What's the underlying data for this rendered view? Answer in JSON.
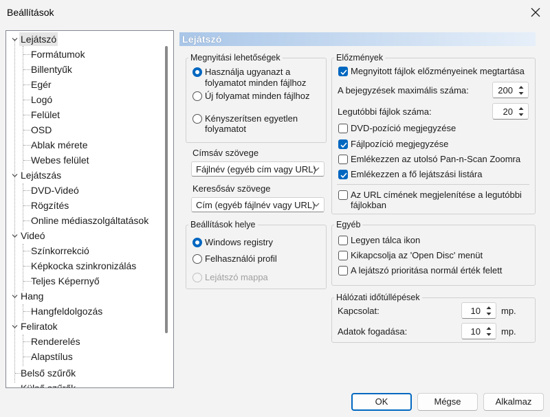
{
  "window": {
    "title": "Beállítások"
  },
  "tree": {
    "items": [
      "Lejátszó",
      "Formátumok",
      "Billentyűk",
      "Egér",
      "Logó",
      "Felület",
      "OSD",
      "Ablak mérete",
      "Webes felület",
      "Lejátszás",
      "DVD-Videó",
      "Rögzítés",
      "Online médiaszolgáltatások",
      "Videó",
      "Színkorrekció",
      "Képkocka szinkronizálás",
      "Teljes Képernyő",
      "Hang",
      "Hangfeldolgozás",
      "Feliratok",
      "Renderelés",
      "Alapstílus",
      "Belső szűrők",
      "Külső szűrők"
    ]
  },
  "page": {
    "title": "Lejátszó"
  },
  "open_options": {
    "title": "Megnyitási lehetőségek",
    "same_line1": "Használja ugyanazt a",
    "same_line2": "folyamatot minden fájlhoz",
    "new": "Új folyamat minden fájlhoz",
    "single_line1": "Kényszerítsen egyetlen",
    "single_line2": "folyamatot",
    "selected": "same"
  },
  "titlebar_text": {
    "label": "Címsáv szövege",
    "value": "Fájlnév (egyéb cím vagy URL)"
  },
  "searchbar_text": {
    "label": "Keresősáv szövege",
    "value": "Cím (egyéb fájlnév vagy URL)"
  },
  "settings_location": {
    "title": "Beállítások helye",
    "registry": "Windows registry",
    "profile": "Felhasználói profil",
    "player_folder": "Lejátszó mappa",
    "selected": "registry"
  },
  "history": {
    "title": "Előzmények",
    "keep": {
      "label": "Megnyitott fájlok előzményeinek megtartása",
      "checked": true
    },
    "max_entries": {
      "label": "A bejegyzések maximális száma:",
      "value": "200"
    },
    "recent_files": {
      "label": "Legutóbbi fájlok száma:",
      "value": "20"
    },
    "dvd_pos": {
      "label": "DVD-pozíció megjegyzése",
      "checked": false
    },
    "file_pos": {
      "label": "Fájlpozíció megjegyzése",
      "checked": true
    },
    "pan_scan": {
      "label": "Emlékezzen az utolsó Pan-n-Scan Zoomra",
      "checked": false
    },
    "main_playlist": {
      "label": "Emlékezzen a fő lejátszási listára",
      "checked": true
    },
    "show_url_line1": "Az URL címének megjelenítése a legutóbbi",
    "show_url_line2": "fájlokban",
    "show_url_checked": false
  },
  "other": {
    "title": "Egyéb",
    "tray": "Legyen tálca ikon",
    "open_disc": "Kikapcsolja az 'Open Disc' menüt",
    "priority": "A lejátszó prioritása normál érték felett"
  },
  "timeouts": {
    "title": "Hálózati időtúllépések",
    "connect": {
      "label": "Kapcsolat:",
      "value": "10",
      "unit": "mp."
    },
    "receive": {
      "label": "Adatok fogadása:",
      "value": "10",
      "unit": "mp."
    }
  },
  "buttons": {
    "ok": "OK",
    "cancel": "Mégse",
    "apply": "Alkalmaz"
  },
  "colors": {
    "accent": "#0067c0"
  }
}
